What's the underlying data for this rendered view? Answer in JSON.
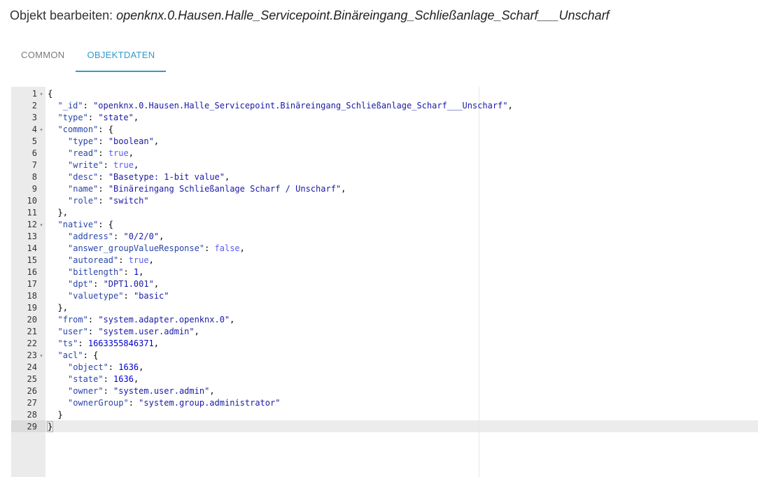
{
  "dialog": {
    "title_prefix": "Objekt bearbeiten: ",
    "object_id": "openknx.0.Hausen.Halle_Servicepoint.Binäreingang_Schließanlage_Scharf___Unscharf"
  },
  "tabs": [
    {
      "label": "COMMON",
      "active": false
    },
    {
      "label": "OBJEKTDATEN",
      "active": true
    }
  ],
  "editor": {
    "lines": [
      {
        "n": "1",
        "fold": true,
        "indent": 0,
        "parts": [
          [
            "p",
            "{"
          ]
        ]
      },
      {
        "n": "2",
        "fold": false,
        "indent": 2,
        "parts": [
          [
            "k",
            "\"_id\""
          ],
          [
            "p",
            ": "
          ],
          [
            "s",
            "\"openknx.0.Hausen.Halle_Servicepoint.Binäreingang_Schließanlage_Scharf___Unscharf\""
          ],
          [
            "p",
            ","
          ]
        ]
      },
      {
        "n": "3",
        "fold": false,
        "indent": 2,
        "parts": [
          [
            "k",
            "\"type\""
          ],
          [
            "p",
            ": "
          ],
          [
            "s",
            "\"state\""
          ],
          [
            "p",
            ","
          ]
        ]
      },
      {
        "n": "4",
        "fold": true,
        "indent": 2,
        "parts": [
          [
            "k",
            "\"common\""
          ],
          [
            "p",
            ": {"
          ]
        ]
      },
      {
        "n": "5",
        "fold": false,
        "indent": 4,
        "parts": [
          [
            "k",
            "\"type\""
          ],
          [
            "p",
            ": "
          ],
          [
            "s",
            "\"boolean\""
          ],
          [
            "p",
            ","
          ]
        ]
      },
      {
        "n": "6",
        "fold": false,
        "indent": 4,
        "parts": [
          [
            "k",
            "\"read\""
          ],
          [
            "p",
            ": "
          ],
          [
            "b",
            "true"
          ],
          [
            "p",
            ","
          ]
        ]
      },
      {
        "n": "7",
        "fold": false,
        "indent": 4,
        "parts": [
          [
            "k",
            "\"write\""
          ],
          [
            "p",
            ": "
          ],
          [
            "b",
            "true"
          ],
          [
            "p",
            ","
          ]
        ]
      },
      {
        "n": "8",
        "fold": false,
        "indent": 4,
        "parts": [
          [
            "k",
            "\"desc\""
          ],
          [
            "p",
            ": "
          ],
          [
            "s",
            "\"Basetype: 1-bit value\""
          ],
          [
            "p",
            ","
          ]
        ]
      },
      {
        "n": "9",
        "fold": false,
        "indent": 4,
        "parts": [
          [
            "k",
            "\"name\""
          ],
          [
            "p",
            ": "
          ],
          [
            "s",
            "\"Binäreingang Schließanlage Scharf / Unscharf\""
          ],
          [
            "p",
            ","
          ]
        ]
      },
      {
        "n": "10",
        "fold": false,
        "indent": 4,
        "parts": [
          [
            "k",
            "\"role\""
          ],
          [
            "p",
            ": "
          ],
          [
            "s",
            "\"switch\""
          ]
        ]
      },
      {
        "n": "11",
        "fold": false,
        "indent": 2,
        "parts": [
          [
            "p",
            "},"
          ]
        ]
      },
      {
        "n": "12",
        "fold": true,
        "indent": 2,
        "parts": [
          [
            "k",
            "\"native\""
          ],
          [
            "p",
            ": {"
          ]
        ]
      },
      {
        "n": "13",
        "fold": false,
        "indent": 4,
        "parts": [
          [
            "k",
            "\"address\""
          ],
          [
            "p",
            ": "
          ],
          [
            "s",
            "\"0/2/0\""
          ],
          [
            "p",
            ","
          ]
        ]
      },
      {
        "n": "14",
        "fold": false,
        "indent": 4,
        "parts": [
          [
            "k",
            "\"answer_groupValueResponse\""
          ],
          [
            "p",
            ": "
          ],
          [
            "b",
            "false"
          ],
          [
            "p",
            ","
          ]
        ]
      },
      {
        "n": "15",
        "fold": false,
        "indent": 4,
        "parts": [
          [
            "k",
            "\"autoread\""
          ],
          [
            "p",
            ": "
          ],
          [
            "b",
            "true"
          ],
          [
            "p",
            ","
          ]
        ]
      },
      {
        "n": "16",
        "fold": false,
        "indent": 4,
        "parts": [
          [
            "k",
            "\"bitlength\""
          ],
          [
            "p",
            ": "
          ],
          [
            "n",
            "1"
          ],
          [
            "p",
            ","
          ]
        ]
      },
      {
        "n": "17",
        "fold": false,
        "indent": 4,
        "parts": [
          [
            "k",
            "\"dpt\""
          ],
          [
            "p",
            ": "
          ],
          [
            "s",
            "\"DPT1.001\""
          ],
          [
            "p",
            ","
          ]
        ]
      },
      {
        "n": "18",
        "fold": false,
        "indent": 4,
        "parts": [
          [
            "k",
            "\"valuetype\""
          ],
          [
            "p",
            ": "
          ],
          [
            "s",
            "\"basic\""
          ]
        ]
      },
      {
        "n": "19",
        "fold": false,
        "indent": 2,
        "parts": [
          [
            "p",
            "},"
          ]
        ]
      },
      {
        "n": "20",
        "fold": false,
        "indent": 2,
        "parts": [
          [
            "k",
            "\"from\""
          ],
          [
            "p",
            ": "
          ],
          [
            "s",
            "\"system.adapter.openknx.0\""
          ],
          [
            "p",
            ","
          ]
        ]
      },
      {
        "n": "21",
        "fold": false,
        "indent": 2,
        "parts": [
          [
            "k",
            "\"user\""
          ],
          [
            "p",
            ": "
          ],
          [
            "s",
            "\"system.user.admin\""
          ],
          [
            "p",
            ","
          ]
        ]
      },
      {
        "n": "22",
        "fold": false,
        "indent": 2,
        "parts": [
          [
            "k",
            "\"ts\""
          ],
          [
            "p",
            ": "
          ],
          [
            "n",
            "1663355846371"
          ],
          [
            "p",
            ","
          ]
        ]
      },
      {
        "n": "23",
        "fold": true,
        "indent": 2,
        "parts": [
          [
            "k",
            "\"acl\""
          ],
          [
            "p",
            ": {"
          ]
        ]
      },
      {
        "n": "24",
        "fold": false,
        "indent": 4,
        "parts": [
          [
            "k",
            "\"object\""
          ],
          [
            "p",
            ": "
          ],
          [
            "n",
            "1636"
          ],
          [
            "p",
            ","
          ]
        ]
      },
      {
        "n": "25",
        "fold": false,
        "indent": 4,
        "parts": [
          [
            "k",
            "\"state\""
          ],
          [
            "p",
            ": "
          ],
          [
            "n",
            "1636"
          ],
          [
            "p",
            ","
          ]
        ]
      },
      {
        "n": "26",
        "fold": false,
        "indent": 4,
        "parts": [
          [
            "k",
            "\"owner\""
          ],
          [
            "p",
            ": "
          ],
          [
            "s",
            "\"system.user.admin\""
          ],
          [
            "p",
            ","
          ]
        ]
      },
      {
        "n": "27",
        "fold": false,
        "indent": 4,
        "parts": [
          [
            "k",
            "\"ownerGroup\""
          ],
          [
            "p",
            ": "
          ],
          [
            "s",
            "\"system.group.administrator\""
          ]
        ]
      },
      {
        "n": "28",
        "fold": false,
        "indent": 2,
        "parts": [
          [
            "p",
            "}"
          ]
        ]
      },
      {
        "n": "29",
        "fold": false,
        "indent": 0,
        "parts": [
          [
            "p",
            "}"
          ]
        ]
      }
    ],
    "fold_icon": "caret-down-icon"
  },
  "colors": {
    "accent": "#3399cc",
    "key": "#2a45a8",
    "string": "#1a1aa6",
    "number": "#0000cd",
    "boolean": "#585cf6",
    "gutter": "#ebebeb"
  }
}
